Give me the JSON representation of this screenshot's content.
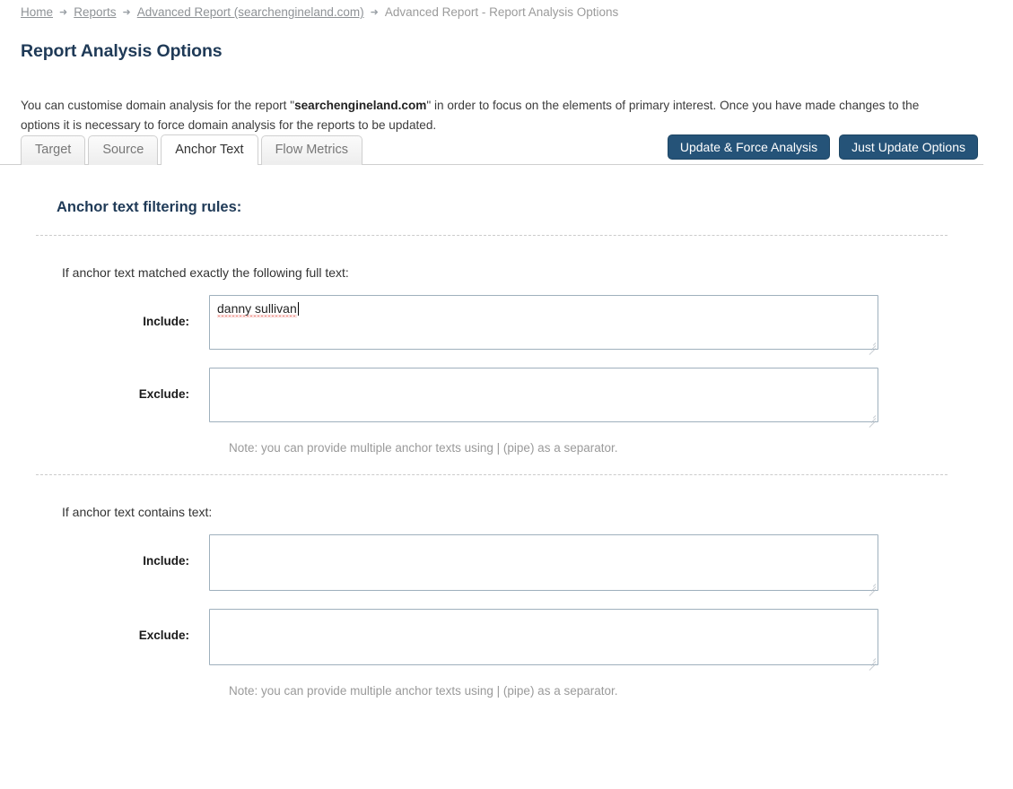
{
  "breadcrumb": {
    "separator_icon": "arrow-right-icon",
    "items": [
      {
        "label": "Home",
        "current": false
      },
      {
        "label": "Reports",
        "current": false
      },
      {
        "label": "Advanced Report (searchengineland.com)",
        "current": false
      },
      {
        "label": "Advanced Report - Report Analysis Options",
        "current": true
      }
    ]
  },
  "page": {
    "title": "Report Analysis Options",
    "intro_before": "You can customise domain analysis for the report \"",
    "intro_domain": "searchengineland.com",
    "intro_after": "\" in order to focus on the elements of primary interest. Once you have made changes to the options it is necessary to force domain analysis for the reports to be updated."
  },
  "tabs": [
    {
      "label": "Target",
      "active": false
    },
    {
      "label": "Source",
      "active": false
    },
    {
      "label": "Anchor Text",
      "active": true
    },
    {
      "label": "Flow Metrics",
      "active": false
    }
  ],
  "actions": {
    "update_force": "Update & Force Analysis",
    "just_update": "Just Update Options"
  },
  "section": {
    "heading": "Anchor text filtering rules:"
  },
  "rules": [
    {
      "prompt": "If anchor text matched exactly the following full text:",
      "include_label": "Include:",
      "include_value": "danny sullivan",
      "exclude_label": "Exclude:",
      "exclude_value": "",
      "note": "Note: you can provide multiple anchor texts using | (pipe) as a separator."
    },
    {
      "prompt": "If anchor text contains text:",
      "include_label": "Include:",
      "include_value": "",
      "exclude_label": "Exclude:",
      "exclude_value": "",
      "note": "Note: you can provide multiple anchor texts using | (pipe) as a separator."
    }
  ],
  "colors": {
    "accent": "#255378",
    "heading": "#1f3a57",
    "muted": "#9a9a9a",
    "field_border": "#9fb0bd",
    "spellcheck": "#e03a2f"
  }
}
